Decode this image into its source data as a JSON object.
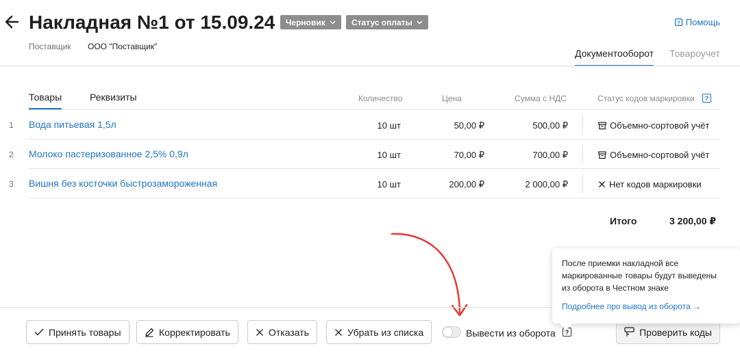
{
  "header": {
    "title": "Накладная №1 от 15.09.24",
    "status_chip": "Черновик",
    "payment_chip": "Статус оплаты",
    "help": "Помощь",
    "supplier_label": "Поставщик",
    "supplier_value": "ООО \"Поставщик\""
  },
  "top_tabs": [
    {
      "label": "Документооборот",
      "active": true
    },
    {
      "label": "Товароучет",
      "active": false
    }
  ],
  "table": {
    "tabs": [
      {
        "label": "Товары",
        "active": true
      },
      {
        "label": "Реквизиты",
        "active": false
      }
    ],
    "columns": {
      "quantity": "Количество",
      "price": "Цена",
      "sum": "Сумма с НДС",
      "status": "Статус кодов маркировки",
      "status_help": "?"
    },
    "rows": [
      {
        "num": "1",
        "name": "Вода питьевая  1,5л",
        "qty": "10 шт",
        "price": "50,00 ₽",
        "sum": "500,00 ₽",
        "status": "Объемно-сортовой учёт",
        "status_icon": "box-icon"
      },
      {
        "num": "2",
        "name": "Молоко пастеризованное 2,5% 0,9л",
        "qty": "10 шт",
        "price": "70,00 ₽",
        "sum": "700,00 ₽",
        "status": "Объемно-сортовой учёт",
        "status_icon": "box-icon"
      },
      {
        "num": "3",
        "name": "Вишня без косточки быстрозамороженная",
        "qty": "10 шт",
        "price": "200,00 ₽",
        "sum": "2 000,00 ₽",
        "status": "Нет кодов маркировки",
        "status_icon": "cross-icon"
      }
    ],
    "total_label": "Итого",
    "total_value": "3 200,00 ₽"
  },
  "popover": {
    "text": "После приемки накладной все маркированные товары будут выведены из оборота в Честном знаке",
    "link": "Подробнее про вывод из оборота →"
  },
  "actions": {
    "accept": "Принять товары",
    "correct": "Корректировать",
    "decline": "Отказать",
    "remove": "Убрать из списка",
    "withdraw_toggle_label": "Вывести из оборота",
    "withdraw_toggle_on": false,
    "withdraw_help": "?",
    "check_codes": "Проверить коды"
  },
  "colors": {
    "accent": "#1e73c9",
    "chip": "#8d8d8d",
    "annotation_arrow": "#e53935"
  }
}
